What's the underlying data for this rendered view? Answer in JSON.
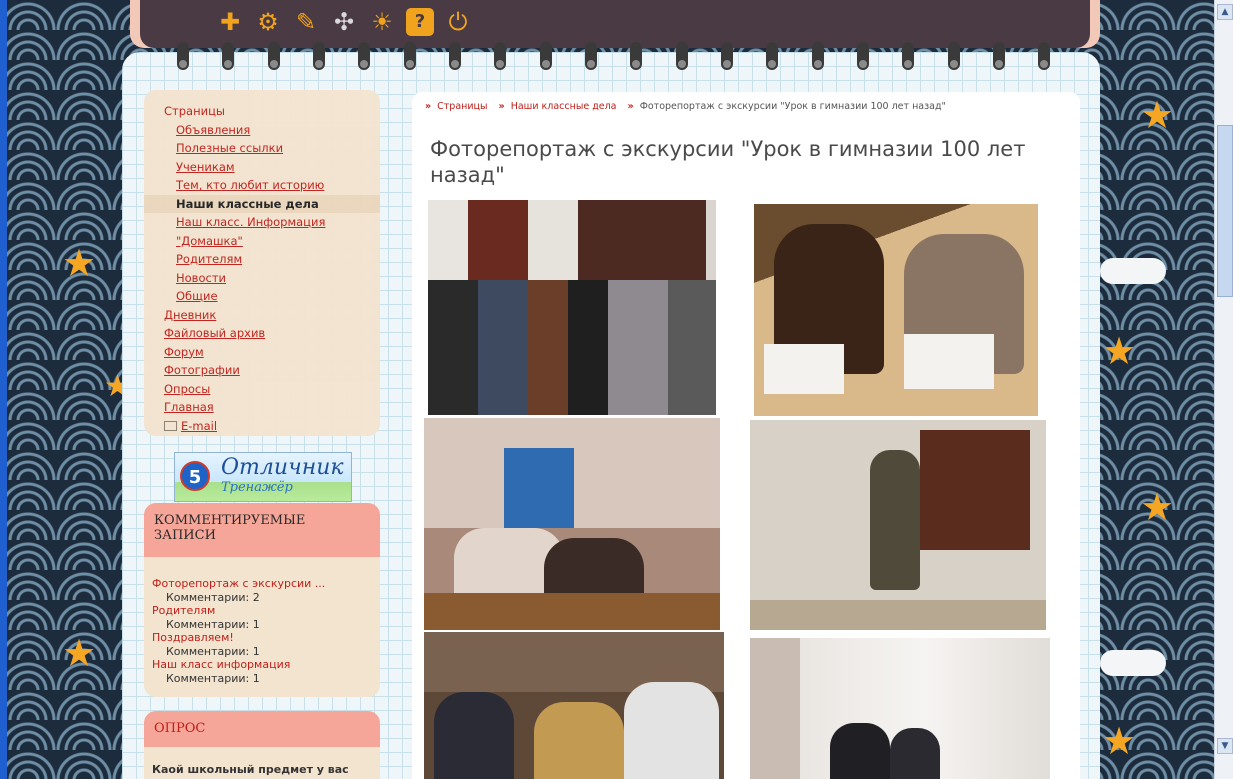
{
  "breadcrumb": {
    "items": [
      "Страницы",
      "Наши классные дела"
    ],
    "current": "Фоторепортаж с экскурсии \"Урок в гимназии 100 лет назад\""
  },
  "page": {
    "title": "Фоторепортаж с экскурсии \"Урок в гимназии 100 лет назад\""
  },
  "toolbar": {
    "icons": [
      "plus-icon",
      "gear-icon",
      "brush-icon",
      "puzzle-icon",
      "lightbulb-icon",
      "help-icon",
      "power-icon"
    ]
  },
  "sidebar": {
    "pages_title": "Страницы",
    "subpages": [
      "Объявления",
      "Полезные ссылки",
      "Ученикам",
      "Тем, кто любит историю"
    ],
    "active": "Наши классные дела",
    "subpages2": [
      "Наш класс. Информация",
      "\"Домашка\"",
      "Родителям",
      "Новости",
      "Общие"
    ],
    "main_items": [
      "Дневник",
      "Файловый архив",
      "Форум",
      "Фотографии",
      "Опросы",
      "Главная"
    ],
    "email": "E-mail"
  },
  "badge": {
    "number": "5",
    "title": "Отличник",
    "subtitle": "Тренажёр"
  },
  "comments_widget": {
    "title": "КОММЕНТИРУЕМЫЕ ЗАПИСИ",
    "entries": [
      {
        "title": "Фоторепортаж с экскурсии ...",
        "count": "Комментарии: 2"
      },
      {
        "title": "Родителям",
        "count": "Комментарии: 1"
      },
      {
        "title": "Поздравляем!",
        "count": "Комментарии: 1"
      },
      {
        "title": "Наш класс информация",
        "count": "Комментарии: 1"
      }
    ]
  },
  "poll_widget": {
    "title": "ОПРОС",
    "question": "Каой школьный предмет у вас"
  },
  "colors": {
    "accent": "#c0201a",
    "toolbar": "#4a3a44",
    "icon": "#f2a31d",
    "sidebar": "#f3e4cf",
    "widget_head": "#f6a599"
  }
}
